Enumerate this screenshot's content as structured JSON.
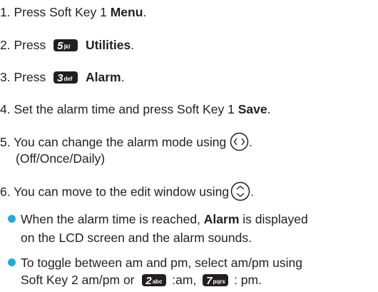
{
  "steps": [
    {
      "num": "1.",
      "text": "Press Soft Key 1",
      "bold": "Menu",
      "end": "."
    },
    {
      "num": "2.",
      "text": "Press",
      "key": {
        "num": "5",
        "letters": "jkl"
      },
      "bold": "Utilities",
      "end": "."
    },
    {
      "num": "3.",
      "text": "Press",
      "key": {
        "num": "3",
        "letters": "def"
      },
      "bold": "Alarm",
      "end": "."
    },
    {
      "num": "4.",
      "text": "Set the alarm time and press Soft Key 1",
      "bold": "Save",
      "end": "."
    },
    {
      "num": "5.",
      "text": "You can change the alarm mode using",
      "end": ".",
      "line2": "(Off/Once/Daily)",
      "icon": "left-right-nav-key-icon"
    },
    {
      "num": "6.",
      "text": "You can move to the edit window using",
      "end": ".",
      "icon": "up-down-nav-key-icon"
    }
  ],
  "notes": [
    {
      "line1_pre": "When the alarm time is reached,",
      "line1_bold": "Alarm",
      "line1_post": "is displayed",
      "line2": "on the LCD screen and the alarm sounds."
    },
    {
      "line1": "To toggle between am and pm, select am/pm using",
      "line2_pre": "Soft Key 2 am/pm or",
      "key_a": {
        "num": "2",
        "letters": "abc"
      },
      "line2_mid": ":am,",
      "key_b": {
        "num": "7",
        "letters": "pqrs"
      },
      "line2_post": ": pm."
    }
  ],
  "colors": {
    "text": "#231f20",
    "bullet": "#22a9e1",
    "key_bg": "#231f20"
  }
}
